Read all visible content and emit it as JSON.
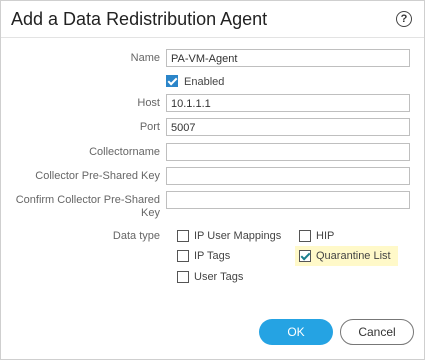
{
  "dialog": {
    "title": "Add a Data Redistribution Agent",
    "help_glyph": "?"
  },
  "fields": {
    "name_label": "Name",
    "name_value": "PA-VM-Agent",
    "enabled_label": "Enabled",
    "enabled_checked": true,
    "host_label": "Host",
    "host_value": "10.1.1.1",
    "port_label": "Port",
    "port_value": "5007",
    "collectorname_label": "Collectorname",
    "collectorname_value": "",
    "psk_label": "Collector Pre-Shared Key",
    "psk_value": "",
    "confirm_psk_label_line1": "Confirm Collector Pre-Shared",
    "confirm_psk_label_line2": "Key",
    "confirm_psk_value": ""
  },
  "data_type": {
    "label": "Data type",
    "options": [
      {
        "label": "IP User Mappings",
        "checked": false
      },
      {
        "label": "HIP",
        "checked": false
      },
      {
        "label": "IP Tags",
        "checked": false
      },
      {
        "label": "Quarantine List",
        "checked": true
      },
      {
        "label": "User Tags",
        "checked": false
      }
    ]
  },
  "buttons": {
    "ok_label": "OK",
    "cancel_label": "Cancel"
  },
  "colors": {
    "accent": "#25a3e3",
    "highlight": "#fff9c9"
  }
}
